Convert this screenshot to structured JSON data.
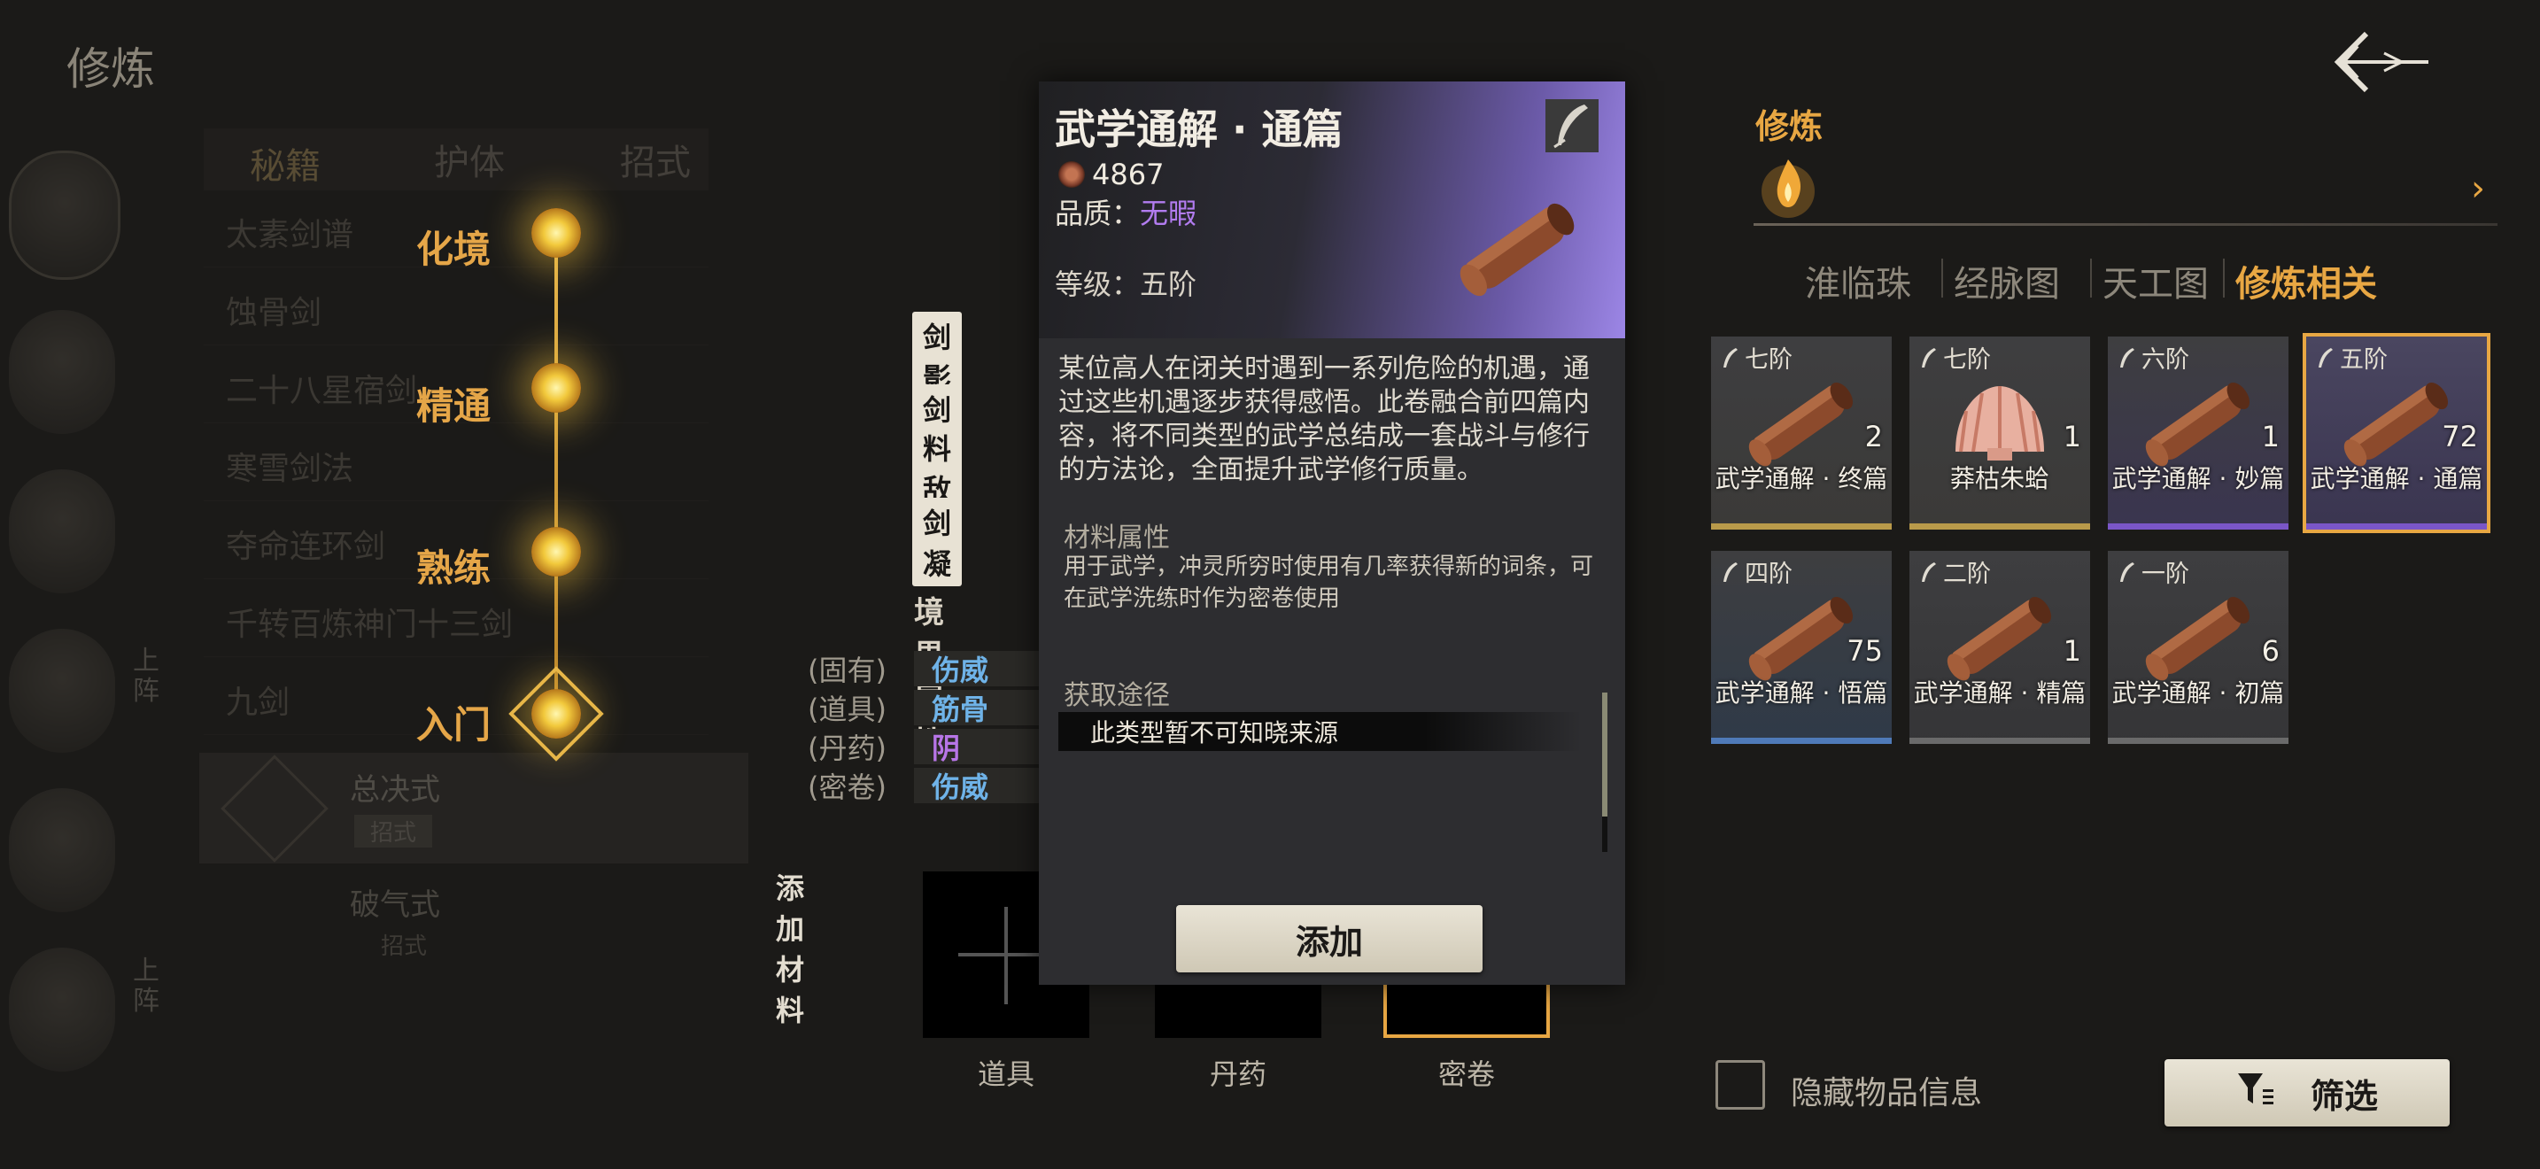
{
  "page_title": "修炼",
  "left": {
    "tabs": [
      "秘籍",
      "护体",
      "招式"
    ],
    "list_items": [
      "太素剑谱",
      "蚀骨剑",
      "二十八星宿剑",
      "寒雪剑法",
      "夺命连环剑",
      "千转百炼神门十三剑",
      "九剑"
    ],
    "sub_items": [
      {
        "name": "总决式",
        "tag": "招式"
      },
      {
        "name": "破气式",
        "tag": "招式"
      }
    ],
    "portrait_badges": [
      "上阵",
      "上阵"
    ],
    "realms": [
      "化境",
      "精通",
      "熟练",
      "入门"
    ],
    "skill_tags": [
      "剑影",
      "剑悟",
      "料敌",
      "剑凝"
    ],
    "realm_attr_title": "境界属性",
    "attributes": [
      {
        "label": "(固有)",
        "value": "伤威",
        "color": "#6fb3e8"
      },
      {
        "label": "(道具)",
        "value": "筋骨",
        "color": "#6fb3e8"
      },
      {
        "label": "(丹药)",
        "value": "阴",
        "color": "#b775e6"
      },
      {
        "label": "(密卷)",
        "value": "伤威",
        "color": "#6fb3e8"
      }
    ],
    "add_material_label": "添加材料",
    "slots": [
      "道具",
      "丹药",
      "密卷"
    ]
  },
  "tooltip": {
    "title": "武学通解 · 通篇",
    "price": "4867",
    "quality_label": "品质：",
    "quality_value": "无暇",
    "quality_color": "#b27cf0",
    "grade": "等级：五阶",
    "description": "某位高人在闭关时遇到一系列危险的机遇，通过这些机遇逐步获得感悟。此卷融合前四篇内容，将不同类型的武学总结成一套战斗与修行的方法论，全面提升武学修行质量。",
    "material_title": "材料属性",
    "material_body": "用于武学，冲灵所穷时使用有几率获得新的词条，可在武学洗练时作为密卷使用",
    "source_title": "获取途径",
    "source_body": "此类型暂不可知晓来源",
    "add_button": "添加"
  },
  "right": {
    "category": "修炼",
    "tabs": [
      "淮临珠",
      "经脉图",
      "天工图",
      "修炼相关"
    ],
    "active_tab": 3,
    "items": [
      {
        "grade": "七阶",
        "count": "2",
        "name": "武学通解 · 终篇",
        "type": "scroll",
        "bar": "#b99a4a",
        "tint": "#3b3a38"
      },
      {
        "grade": "七阶",
        "count": "1",
        "name": "莽枯朱蛤",
        "type": "shell",
        "bar": "#b99a4a",
        "tint": "#3b3a38"
      },
      {
        "grade": "六阶",
        "count": "1",
        "name": "武学通解 · 妙篇",
        "type": "scroll",
        "bar": "#7a56c8",
        "tint": "#3a3550"
      },
      {
        "grade": "五阶",
        "count": "72",
        "name": "武学通解 · 通篇",
        "type": "scroll",
        "bar": "#7a56c8",
        "tint": "#3a3550",
        "selected": true
      },
      {
        "grade": "四阶",
        "count": "75",
        "name": "武学通解 · 悟篇",
        "type": "scroll",
        "bar": "#4f7ab8",
        "tint": "#2f3a48"
      },
      {
        "grade": "二阶",
        "count": "1",
        "name": "武学通解 · 精篇",
        "type": "scroll",
        "bar": "#6a6a6a",
        "tint": "#353537"
      },
      {
        "grade": "一阶",
        "count": "6",
        "name": "武学通解 · 初篇",
        "type": "scroll",
        "bar": "#6a6a6a",
        "tint": "#353537"
      }
    ],
    "hide_info_label": "隐藏物品信息",
    "filter_label": "筛选"
  },
  "colors": {
    "accent": "#e8a743",
    "selected_border": "#e8a743"
  }
}
